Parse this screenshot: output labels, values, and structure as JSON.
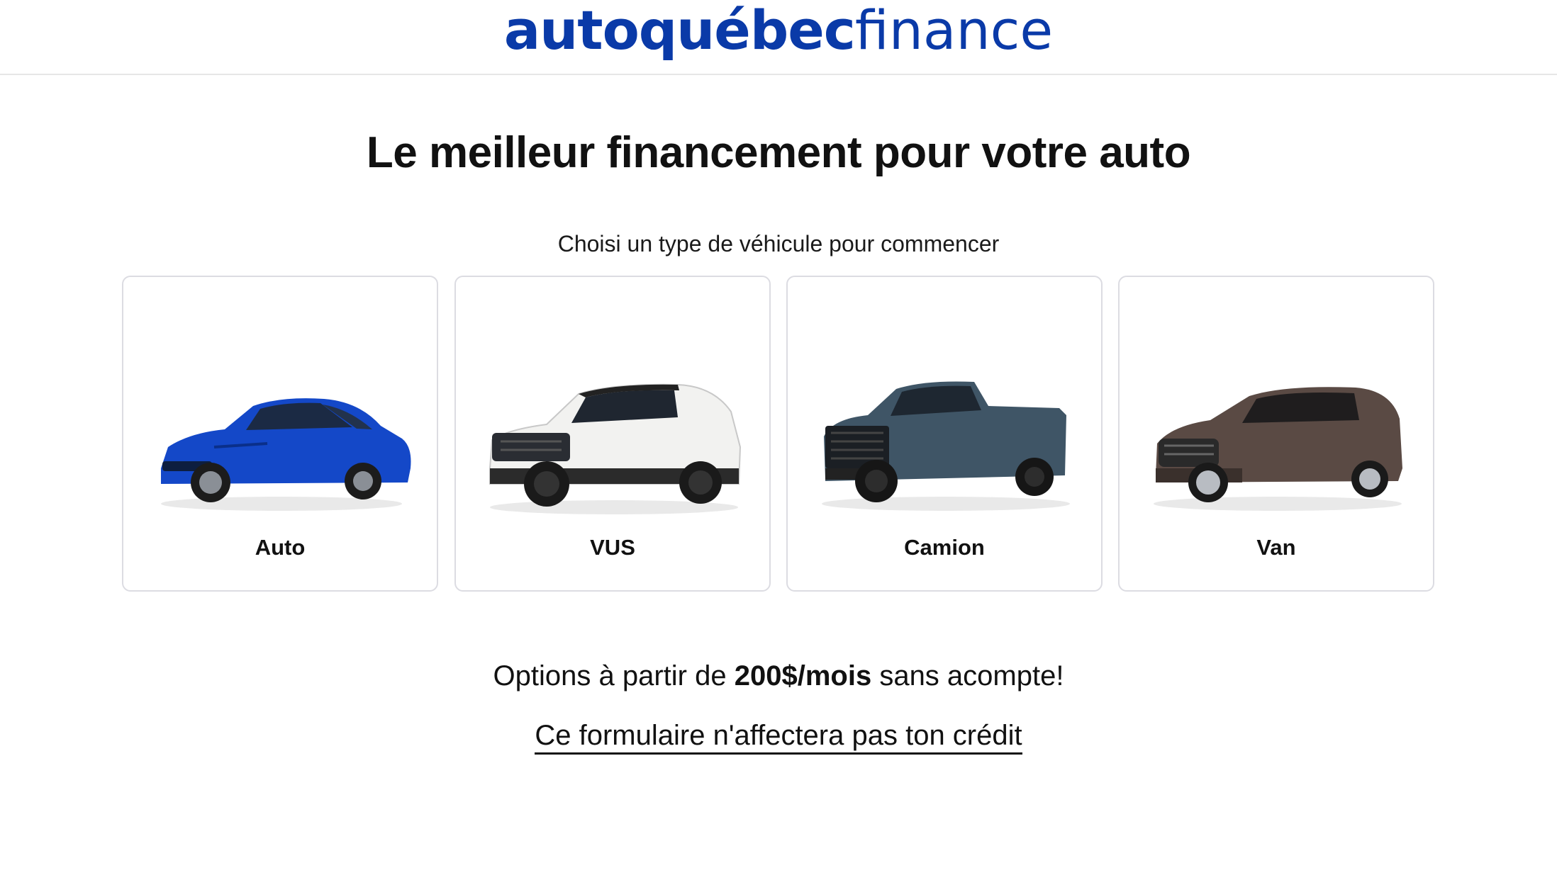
{
  "brand": {
    "logo_bold": "autoquébec",
    "logo_light": "finance",
    "color": "#0a3aa8"
  },
  "hero": {
    "title": "Le meilleur financement pour votre auto",
    "subtitle": "Choisi un type de véhicule pour commencer"
  },
  "vehicle_types": [
    {
      "label": "Auto",
      "icon": "sedan-image",
      "color": "#1448c8"
    },
    {
      "label": "VUS",
      "icon": "suv-image",
      "color": "#f2f2f0"
    },
    {
      "label": "Camion",
      "icon": "pickup-truck-image",
      "color": "#3f5566"
    },
    {
      "label": "Van",
      "icon": "minivan-image",
      "color": "#5a4a44"
    }
  ],
  "offer": {
    "prefix": "Options à partir de ",
    "highlight": "200$/mois",
    "suffix": " sans acompte!"
  },
  "credit_notice": "Ce formulaire n'affectera pas ton crédit"
}
